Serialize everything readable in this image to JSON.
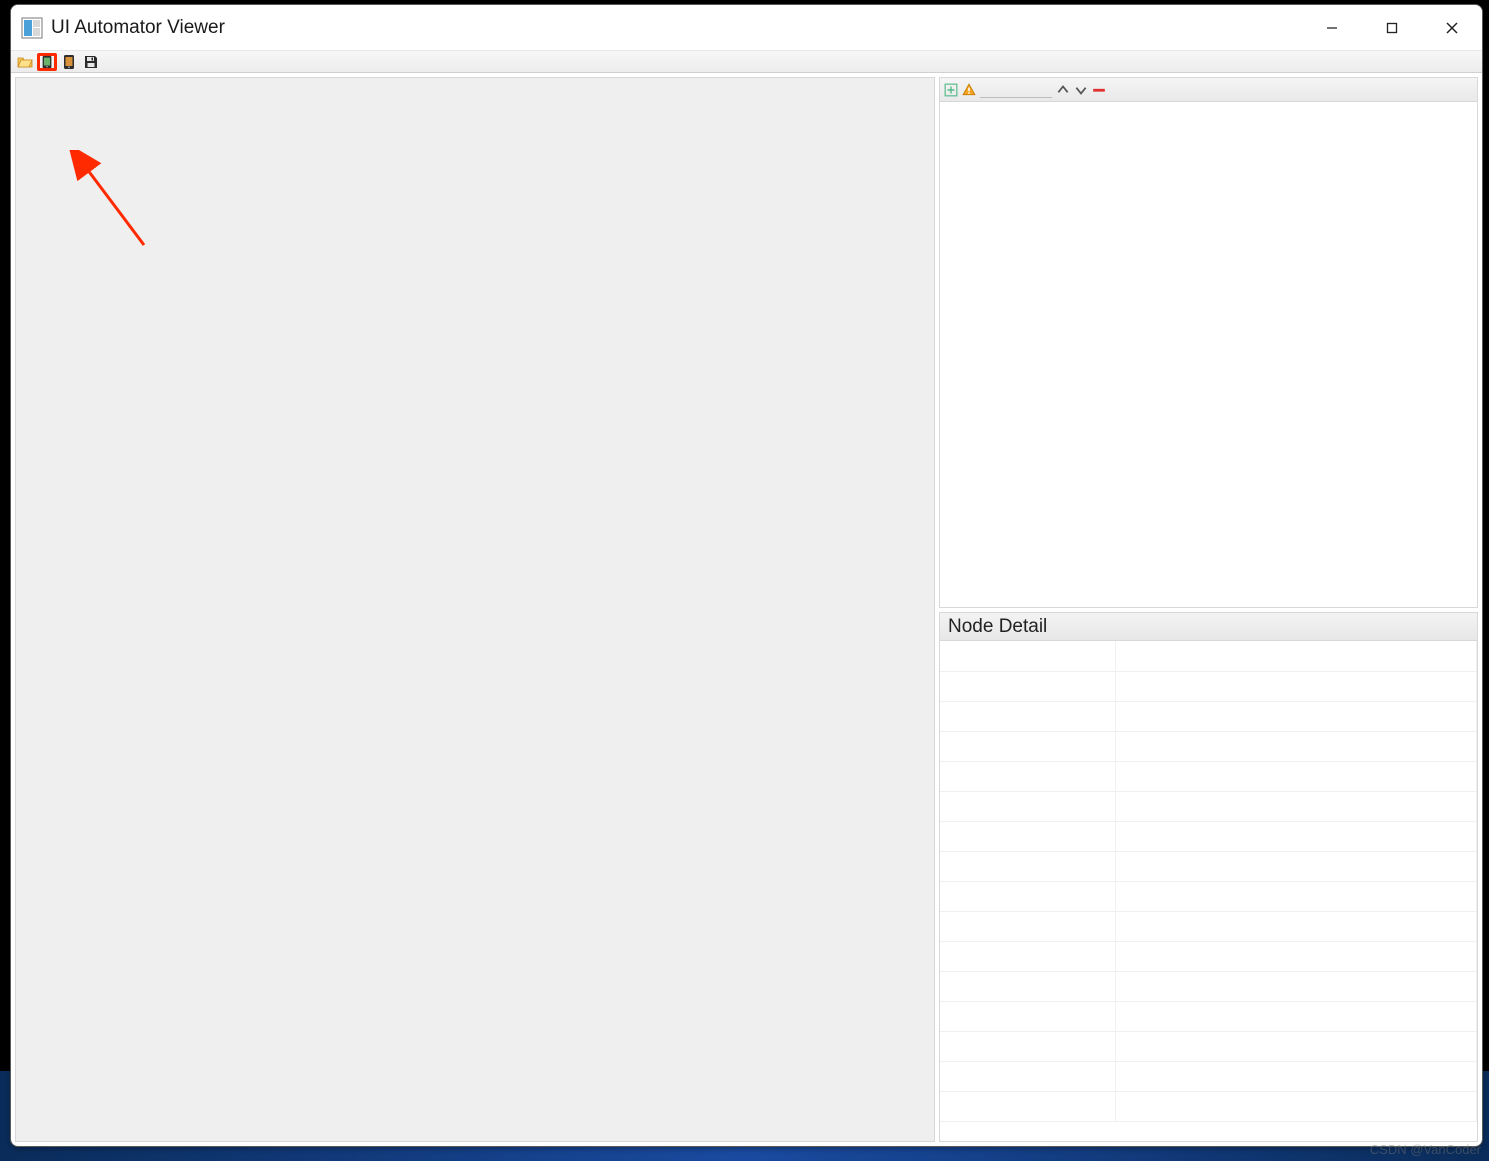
{
  "window": {
    "title": "UI Automator Viewer"
  },
  "toolbar": {
    "open_label": "Open",
    "screenshot_label": "Device Screenshot (uiautomator dump)",
    "screenshot_compressed_label": "Device Screenshot with Compressed Hierarchy",
    "save_label": "Save"
  },
  "tree": {
    "expand_all_label": "Expand All",
    "toggle_naf_label": "Toggle NAF Nodes",
    "search_value": "",
    "search_placeholder": "",
    "prev_label": "Previous",
    "next_label": "Next",
    "clear_label": "Clear"
  },
  "detail": {
    "title": "Node Detail",
    "rows": [
      {
        "k": "",
        "v": ""
      },
      {
        "k": "",
        "v": ""
      },
      {
        "k": "",
        "v": ""
      },
      {
        "k": "",
        "v": ""
      },
      {
        "k": "",
        "v": ""
      },
      {
        "k": "",
        "v": ""
      },
      {
        "k": "",
        "v": ""
      },
      {
        "k": "",
        "v": ""
      },
      {
        "k": "",
        "v": ""
      },
      {
        "k": "",
        "v": ""
      },
      {
        "k": "",
        "v": ""
      },
      {
        "k": "",
        "v": ""
      },
      {
        "k": "",
        "v": ""
      },
      {
        "k": "",
        "v": ""
      },
      {
        "k": "",
        "v": ""
      },
      {
        "k": "",
        "v": ""
      }
    ]
  },
  "watermark": "CSDN @VanCoder"
}
